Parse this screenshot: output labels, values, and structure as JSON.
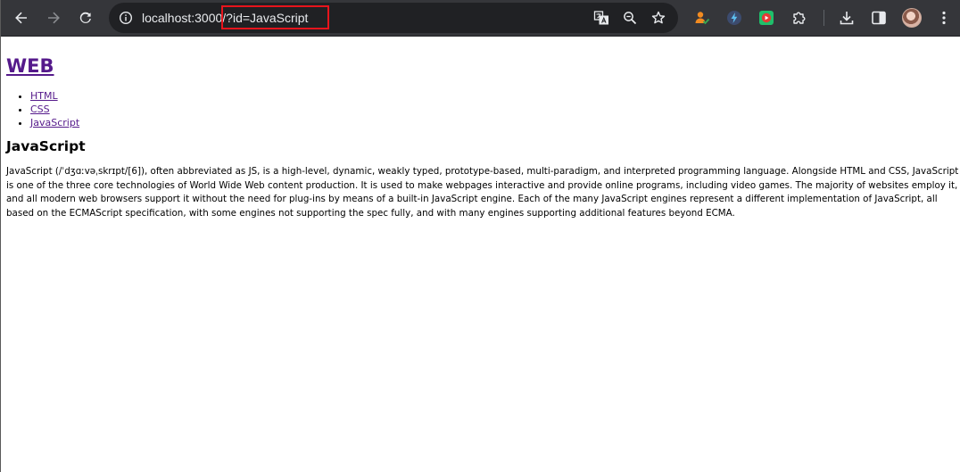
{
  "browser": {
    "url_host": "localhost:3000",
    "url_path": "/?id=JavaScript",
    "icons": {
      "back": "back-arrow-icon",
      "forward": "forward-arrow-icon",
      "reload": "reload-icon",
      "site_info": "info-icon",
      "translate": "translate-icon",
      "zoom": "zoom-icon",
      "bookmark": "star-icon",
      "extension_1": "person-check-icon",
      "extension_2": "lightning-icon",
      "extension_3": "play-icon",
      "extensions": "puzzle-icon",
      "downloads": "download-icon",
      "side_panel": "side-panel-icon",
      "profile": "avatar-icon",
      "menu": "kebab-menu-icon"
    },
    "highlight_color": "#e8141c"
  },
  "page": {
    "site_title": "WEB",
    "nav": [
      "HTML",
      "CSS",
      "JavaScript"
    ],
    "article_title": "JavaScript",
    "article_body": "JavaScript (/ˈdʒɑːvəˌskrɪpt/[6]), often abbreviated as JS, is a high-level, dynamic, weakly typed, prototype-based, multi-paradigm, and interpreted programming language. Alongside HTML and CSS, JavaScript is one of the three core technologies of World Wide Web content production. It is used to make webpages interactive and provide online programs, including video games. The majority of websites employ it, and all modern web browsers support it without the need for plug-ins by means of a built-in JavaScript engine. Each of the many JavaScript engines represent a different implementation of JavaScript, all based on the ECMAScript specification, with some engines not supporting the spec fully, and with many engines supporting additional features beyond ECMA.",
    "link_color": "#551a8b"
  }
}
